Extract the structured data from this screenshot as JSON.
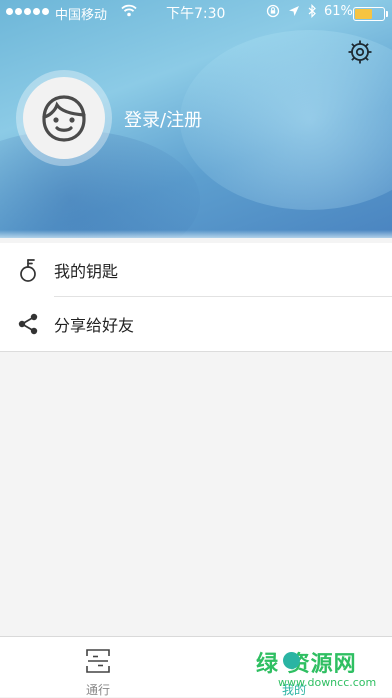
{
  "status_bar": {
    "carrier": "中国移动",
    "time": "下午7:30",
    "battery_percent": "61%",
    "battery_level": 0.61,
    "battery_color": "#f6c442"
  },
  "header": {
    "settings_icon": "gear-icon",
    "avatar_icon": "user-avatar-icon",
    "login_label": "登录/注册"
  },
  "menu": {
    "items": [
      {
        "icon": "key-icon",
        "label": "我的钥匙"
      },
      {
        "icon": "share-icon",
        "label": "分享给好友"
      }
    ]
  },
  "tab_bar": {
    "tabs": [
      {
        "icon": "scan-icon",
        "label": "通行",
        "active": false
      },
      {
        "icon": "profile-icon",
        "label": "我的",
        "active": true
      }
    ],
    "active_color": "#2ab4a3"
  },
  "watermark": {
    "main": "绿 资源网",
    "sub": "www.downcc.com"
  }
}
